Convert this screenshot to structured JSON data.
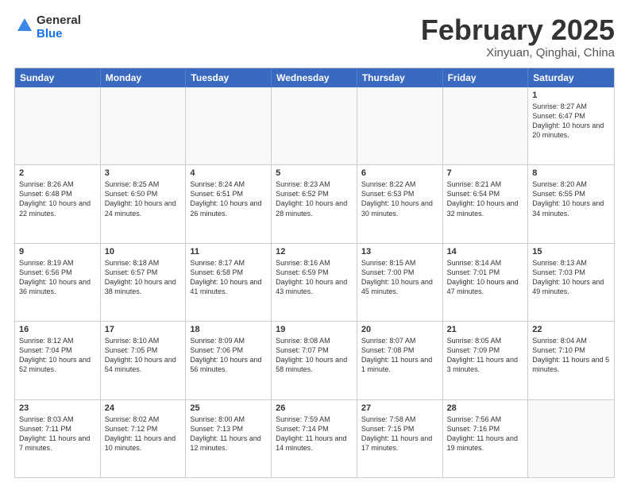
{
  "header": {
    "logo_general": "General",
    "logo_blue": "Blue",
    "month_title": "February 2025",
    "location": "Xinyuan, Qinghai, China"
  },
  "days_of_week": [
    "Sunday",
    "Monday",
    "Tuesday",
    "Wednesday",
    "Thursday",
    "Friday",
    "Saturday"
  ],
  "weeks": [
    [
      {
        "day": "",
        "text": ""
      },
      {
        "day": "",
        "text": ""
      },
      {
        "day": "",
        "text": ""
      },
      {
        "day": "",
        "text": ""
      },
      {
        "day": "",
        "text": ""
      },
      {
        "day": "",
        "text": ""
      },
      {
        "day": "1",
        "text": "Sunrise: 8:27 AM\nSunset: 6:47 PM\nDaylight: 10 hours and 20 minutes."
      }
    ],
    [
      {
        "day": "2",
        "text": "Sunrise: 8:26 AM\nSunset: 6:48 PM\nDaylight: 10 hours and 22 minutes."
      },
      {
        "day": "3",
        "text": "Sunrise: 8:25 AM\nSunset: 6:50 PM\nDaylight: 10 hours and 24 minutes."
      },
      {
        "day": "4",
        "text": "Sunrise: 8:24 AM\nSunset: 6:51 PM\nDaylight: 10 hours and 26 minutes."
      },
      {
        "day": "5",
        "text": "Sunrise: 8:23 AM\nSunset: 6:52 PM\nDaylight: 10 hours and 28 minutes."
      },
      {
        "day": "6",
        "text": "Sunrise: 8:22 AM\nSunset: 6:53 PM\nDaylight: 10 hours and 30 minutes."
      },
      {
        "day": "7",
        "text": "Sunrise: 8:21 AM\nSunset: 6:54 PM\nDaylight: 10 hours and 32 minutes."
      },
      {
        "day": "8",
        "text": "Sunrise: 8:20 AM\nSunset: 6:55 PM\nDaylight: 10 hours and 34 minutes."
      }
    ],
    [
      {
        "day": "9",
        "text": "Sunrise: 8:19 AM\nSunset: 6:56 PM\nDaylight: 10 hours and 36 minutes."
      },
      {
        "day": "10",
        "text": "Sunrise: 8:18 AM\nSunset: 6:57 PM\nDaylight: 10 hours and 38 minutes."
      },
      {
        "day": "11",
        "text": "Sunrise: 8:17 AM\nSunset: 6:58 PM\nDaylight: 10 hours and 41 minutes."
      },
      {
        "day": "12",
        "text": "Sunrise: 8:16 AM\nSunset: 6:59 PM\nDaylight: 10 hours and 43 minutes."
      },
      {
        "day": "13",
        "text": "Sunrise: 8:15 AM\nSunset: 7:00 PM\nDaylight: 10 hours and 45 minutes."
      },
      {
        "day": "14",
        "text": "Sunrise: 8:14 AM\nSunset: 7:01 PM\nDaylight: 10 hours and 47 minutes."
      },
      {
        "day": "15",
        "text": "Sunrise: 8:13 AM\nSunset: 7:03 PM\nDaylight: 10 hours and 49 minutes."
      }
    ],
    [
      {
        "day": "16",
        "text": "Sunrise: 8:12 AM\nSunset: 7:04 PM\nDaylight: 10 hours and 52 minutes."
      },
      {
        "day": "17",
        "text": "Sunrise: 8:10 AM\nSunset: 7:05 PM\nDaylight: 10 hours and 54 minutes."
      },
      {
        "day": "18",
        "text": "Sunrise: 8:09 AM\nSunset: 7:06 PM\nDaylight: 10 hours and 56 minutes."
      },
      {
        "day": "19",
        "text": "Sunrise: 8:08 AM\nSunset: 7:07 PM\nDaylight: 10 hours and 58 minutes."
      },
      {
        "day": "20",
        "text": "Sunrise: 8:07 AM\nSunset: 7:08 PM\nDaylight: 11 hours and 1 minute."
      },
      {
        "day": "21",
        "text": "Sunrise: 8:05 AM\nSunset: 7:09 PM\nDaylight: 11 hours and 3 minutes."
      },
      {
        "day": "22",
        "text": "Sunrise: 8:04 AM\nSunset: 7:10 PM\nDaylight: 11 hours and 5 minutes."
      }
    ],
    [
      {
        "day": "23",
        "text": "Sunrise: 8:03 AM\nSunset: 7:11 PM\nDaylight: 11 hours and 7 minutes."
      },
      {
        "day": "24",
        "text": "Sunrise: 8:02 AM\nSunset: 7:12 PM\nDaylight: 11 hours and 10 minutes."
      },
      {
        "day": "25",
        "text": "Sunrise: 8:00 AM\nSunset: 7:13 PM\nDaylight: 11 hours and 12 minutes."
      },
      {
        "day": "26",
        "text": "Sunrise: 7:59 AM\nSunset: 7:14 PM\nDaylight: 11 hours and 14 minutes."
      },
      {
        "day": "27",
        "text": "Sunrise: 7:58 AM\nSunset: 7:15 PM\nDaylight: 11 hours and 17 minutes."
      },
      {
        "day": "28",
        "text": "Sunrise: 7:56 AM\nSunset: 7:16 PM\nDaylight: 11 hours and 19 minutes."
      },
      {
        "day": "",
        "text": ""
      }
    ]
  ]
}
